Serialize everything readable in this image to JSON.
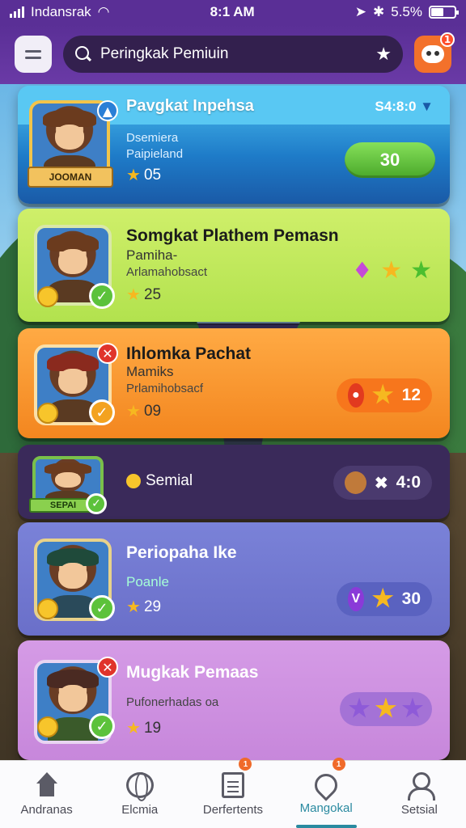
{
  "status_bar": {
    "carrier": "Indansrak",
    "time": "8:1 AM",
    "battery": "5.5%",
    "battery_level": 0.55
  },
  "header": {
    "search_text": "Peringkak Pemiuin",
    "notification_count": "1"
  },
  "cards": [
    {
      "title": "Pavgkat Inpehsa",
      "meta": "S4:8:0",
      "line1": "Dsemiera",
      "line2": "Paipieland",
      "rating": "05",
      "button": "30",
      "banner": "JOOMAN"
    },
    {
      "title": "Somgkat Plathem Pemasn",
      "line1": "Pamiha-",
      "line2": "Arlamahobsact",
      "rating": "25"
    },
    {
      "title": "Ihlomka Pachat",
      "line1": "Mamiks",
      "line2": "Prlamihobsacf",
      "rating": "09",
      "pill_value": "12"
    },
    {
      "label": "Semial",
      "pill_value": "4:0",
      "banner": "SEPAI"
    },
    {
      "title": "Periopaha Ike",
      "line1": "Poanle",
      "rating": "29",
      "pill_value": "30"
    },
    {
      "title": "Mugkak Pemaas",
      "line2": "Pufonerhadas oa",
      "rating": "19"
    }
  ],
  "bottom_nav": [
    {
      "label": "Andranas",
      "icon": "home-icon"
    },
    {
      "label": "Elcmia",
      "icon": "globe-icon"
    },
    {
      "label": "Derfertents",
      "icon": "document-icon",
      "badge": "1"
    },
    {
      "label": "Mangokal",
      "icon": "location-pin-icon",
      "badge": "1",
      "active": true
    },
    {
      "label": "Setsial",
      "icon": "user-icon"
    }
  ]
}
